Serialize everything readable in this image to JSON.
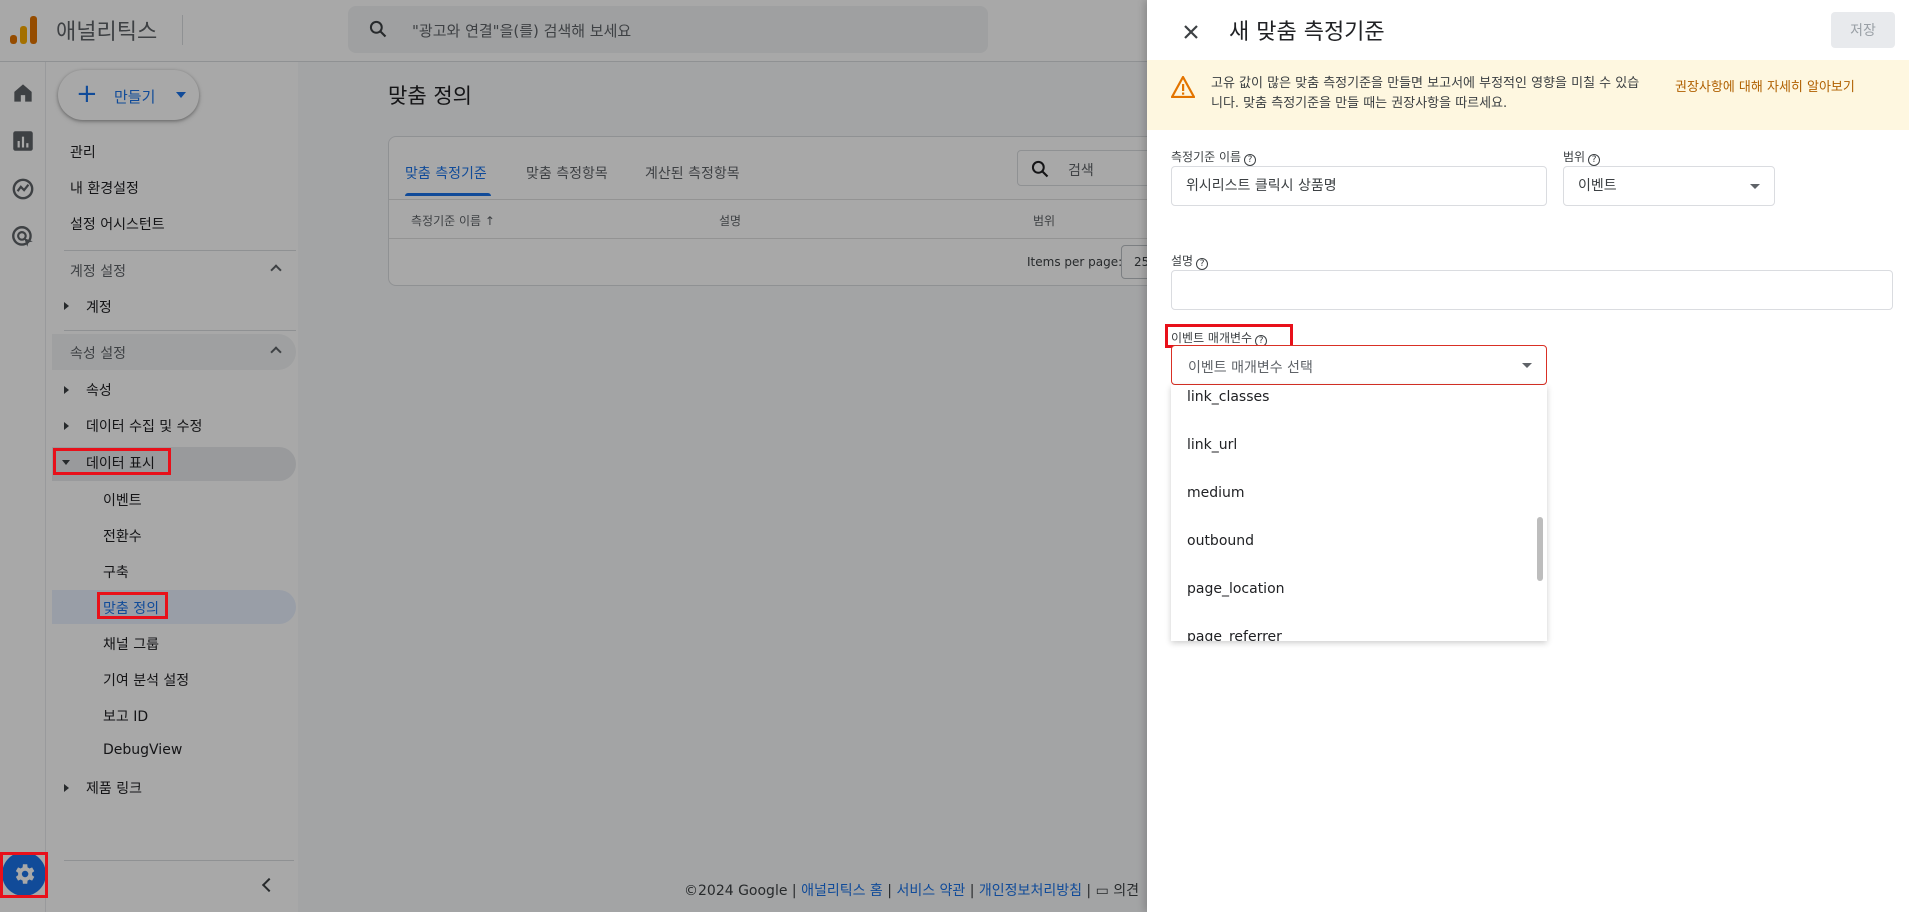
{
  "app": {
    "title": "애널리틱스",
    "search_placeholder": "\"광고와 연결\"을(를) 검색해 보세요"
  },
  "sidenav": {
    "create_label": "만들기",
    "top_items": [
      "관리",
      "내 환경설정",
      "설정 어시스턴트"
    ],
    "account_section": "계정 설정",
    "account_item": "계정",
    "property_section": "속성 설정",
    "property_item": "속성",
    "data_collection": "데이터 수집 및 수정",
    "data_display": "데이터 표시",
    "sub_items": [
      "이벤트",
      "전환수",
      "구축",
      "맞춤 정의",
      "채널 그룹",
      "기여 분석 설정",
      "보고 ID",
      "DebugView"
    ],
    "product_links": "제품 링크"
  },
  "content": {
    "page_title": "맞춤 정의",
    "tabs": [
      "맞춤 측정기준",
      "맞춤 측정항목",
      "계산된 측정항목"
    ],
    "search_placeholder": "검색",
    "columns": [
      "측정기준 이름 ↑",
      "설명",
      "범위"
    ],
    "items_per_page_label": "Items per page:",
    "items_per_page_value": "25",
    "footer": {
      "copyright": "©2024 Google |",
      "home": "애널리틱스 홈",
      "sep1": "|",
      "terms": "서비스 약관",
      "sep2": "|",
      "privacy": "개인정보처리방침",
      "sep3": "|",
      "feedback": "의견"
    }
  },
  "panel": {
    "title": "새 맞춤 측정기준",
    "save_label": "저장",
    "warning_text": "고유 값이 많은 맞춤 측정기준을 만들면 보고서에 부정적인 영향을 미칠 수 있습니다. 맞춤 측정기준을 만들 때는 권장사항을 따르세요.",
    "warning_link": "권장사항에 대해 자세히 알아보기",
    "name_label": "측정기준 이름",
    "name_value": "위시리스트 클릭시 상품명",
    "scope_label": "범위",
    "scope_value": "이벤트",
    "desc_label": "설명",
    "desc_value": "",
    "param_label": "이벤트 매개변수",
    "param_placeholder": "이벤트 매개변수 선택",
    "param_options": [
      "link_classes",
      "link_url",
      "medium",
      "outbound",
      "page_location",
      "page_referrer"
    ]
  },
  "colors": {
    "accent": "#1a73e8",
    "highlight": "#e8101a",
    "warning_bg": "#fef7e0",
    "warning_icon": "#e37400"
  }
}
